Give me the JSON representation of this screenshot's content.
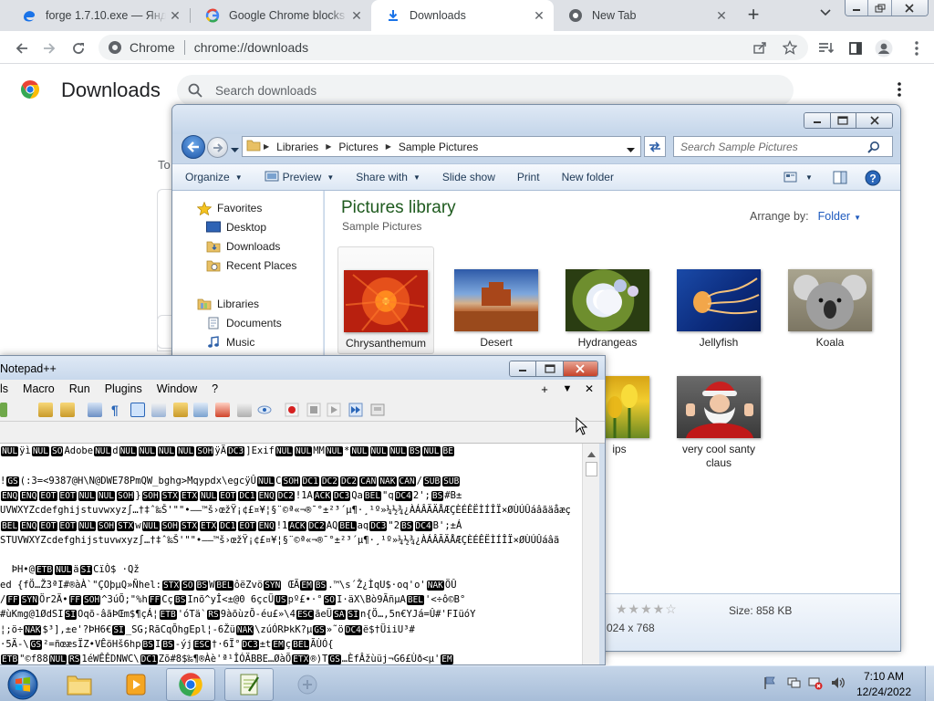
{
  "chrome": {
    "tabs": [
      {
        "label": "forge 1.7.10.exe — Яндекс",
        "icon": "edge-icon",
        "active": false
      },
      {
        "label": "Google Chrome blocks so",
        "icon": "google-g-icon",
        "active": false
      },
      {
        "label": "Downloads",
        "icon": "download-arrow-icon",
        "active": true
      },
      {
        "label": "New Tab",
        "icon": "chrome-icon",
        "active": false
      }
    ],
    "omnibox": {
      "site": "Chrome",
      "url": "chrome://downloads"
    },
    "page": {
      "title": "Downloads",
      "search_placeholder": "Search downloads",
      "date_heading_partial": "To"
    }
  },
  "explorer": {
    "breadcrumb": [
      "Libraries",
      "Pictures",
      "Sample Pictures"
    ],
    "search_placeholder": "Search Sample Pictures",
    "commands": [
      {
        "label": "Organize",
        "dropdown": true
      },
      {
        "label": "Preview",
        "dropdown": true
      },
      {
        "label": "Share with",
        "dropdown": true
      },
      {
        "label": "Slide show",
        "dropdown": false
      },
      {
        "label": "Print",
        "dropdown": false
      },
      {
        "label": "New folder",
        "dropdown": false
      }
    ],
    "nav": {
      "favorites_header": "Favorites",
      "favorites": [
        "Desktop",
        "Downloads",
        "Recent Places"
      ],
      "libraries_header": "Libraries",
      "libraries": [
        "Documents",
        "Music"
      ]
    },
    "library_title": "Pictures library",
    "library_subtitle": "Sample Pictures",
    "arrange_label": "Arrange by:",
    "arrange_value": "Folder",
    "thumbnails_row1": [
      "Chrysanthemum",
      "Desert",
      "Hydrangeas",
      "Jellyfish",
      "Koala"
    ],
    "thumbnails_row2_partial": "ips",
    "thumbnail_extra": "very cool santy claus",
    "details": {
      "size": "Size: 858 KB",
      "dimensions_partial": "024 x 768"
    }
  },
  "notepad": {
    "title_partial": "Notepad++",
    "menus": [
      "ls",
      "Macro",
      "Run",
      "Plugins",
      "Window",
      "?"
    ],
    "menu_right": [
      "+",
      "▼",
      "✕"
    ],
    "lines": [
      {
        "segs": [
          [
            "c",
            "NUL"
          ],
          [
            "t",
            "ÿì"
          ],
          [
            "c",
            "NUL"
          ],
          [
            "c",
            "SO"
          ],
          [
            "t",
            "Adobe"
          ],
          [
            "c",
            "NUL"
          ],
          [
            "t",
            "d"
          ],
          [
            "c",
            "NUL"
          ],
          [
            "c",
            "NUL"
          ],
          [
            "c",
            "NUL"
          ],
          [
            "c",
            "NUL"
          ],
          [
            "c",
            "SOH"
          ],
          [
            "t",
            "ÿÄ"
          ],
          [
            "c",
            "DC3"
          ],
          [
            "t",
            "]Exif"
          ],
          [
            "c",
            "NUL"
          ],
          [
            "c",
            "NUL"
          ],
          [
            "t",
            "MM"
          ],
          [
            "c",
            "NUL"
          ],
          [
            "t",
            "*"
          ],
          [
            "c",
            "NUL"
          ],
          [
            "c",
            "NUL"
          ],
          [
            "c",
            "NUL"
          ],
          [
            "c",
            "BS"
          ],
          [
            "c",
            "NUL"
          ],
          [
            "c",
            "BE"
          ]
        ]
      },
      {
        "segs": []
      },
      {
        "segs": [
          [
            "t",
            "!"
          ],
          [
            "c",
            "GS"
          ],
          [
            "t",
            "(:3=<9387@H\\N@DWE78PmQW_bghg>Mqypdx\\egcÿÛ"
          ],
          [
            "c",
            "NUL"
          ],
          [
            "t",
            "C"
          ],
          [
            "c",
            "SOH"
          ],
          [
            "c",
            "DC1"
          ],
          [
            "c",
            "DC2"
          ],
          [
            "c",
            "DC2"
          ],
          [
            "c",
            "CAN"
          ],
          [
            "c",
            "NAK"
          ],
          [
            "c",
            "CAN"
          ],
          [
            "t",
            "/"
          ],
          [
            "c",
            "SUB"
          ],
          [
            "c",
            "SUB"
          ]
        ]
      },
      {
        "segs": [
          [
            "c",
            "ENQ"
          ],
          [
            "c",
            "ENQ"
          ],
          [
            "c",
            "EOT"
          ],
          [
            "c",
            "EOT"
          ],
          [
            "c",
            "NUL"
          ],
          [
            "c",
            "NUL"
          ],
          [
            "c",
            "SOH"
          ],
          [
            "t",
            "}"
          ],
          [
            "c",
            "SOH"
          ],
          [
            "c",
            "STX"
          ],
          [
            "c",
            "ETX"
          ],
          [
            "c",
            "NUL"
          ],
          [
            "c",
            "EOT"
          ],
          [
            "c",
            "DC1"
          ],
          [
            "c",
            "ENQ"
          ],
          [
            "c",
            "DC2"
          ],
          [
            "t",
            "!1A"
          ],
          [
            "c",
            "ACK"
          ],
          [
            "c",
            "DC3"
          ],
          [
            "t",
            "Qa"
          ],
          [
            "c",
            "BEL"
          ],
          [
            "t",
            "\"q"
          ],
          [
            "c",
            "DC4"
          ],
          [
            "t",
            "2';"
          ],
          [
            "c",
            "BS"
          ],
          [
            "t",
            "#B±"
          ]
        ]
      },
      {
        "segs": [
          [
            "t",
            "UVWXYZcdefghijstuvwxyz∫…†‡ˆ‰Š'\"\"•–—™š›œžŸ¡¢£¤¥¦§¨©ª«¬­®¯°±²³´µ¶·¸¹º»¼½¾¿ÀÁÂÃÄÅÆÇÈÉÊËÌÍÎÏ×ØÙÚÛáâãäåæç"
          ]
        ]
      },
      {
        "segs": [
          [
            "c",
            "BEL"
          ],
          [
            "c",
            "ENQ"
          ],
          [
            "c",
            "EOT"
          ],
          [
            "c",
            "EOT"
          ],
          [
            "c",
            "NUL"
          ],
          [
            "c",
            "SOH"
          ],
          [
            "c",
            "STX"
          ],
          [
            "t",
            "w"
          ],
          [
            "c",
            "NUL"
          ],
          [
            "c",
            "SOH"
          ],
          [
            "c",
            "STX"
          ],
          [
            "c",
            "ETX"
          ],
          [
            "c",
            "DC1"
          ],
          [
            "c",
            "EOT"
          ],
          [
            "c",
            "ENQ"
          ],
          [
            "t",
            "!1"
          ],
          [
            "c",
            "ACK"
          ],
          [
            "c",
            "DC2"
          ],
          [
            "t",
            "AQ"
          ],
          [
            "c",
            "BEL"
          ],
          [
            "t",
            "aq"
          ],
          [
            "c",
            "DC3"
          ],
          [
            "t",
            "\"2"
          ],
          [
            "c",
            "BS"
          ],
          [
            "c",
            "DC4"
          ],
          [
            "t",
            "B';±Á"
          ]
        ]
      },
      {
        "segs": [
          [
            "t",
            "STUVWXYZcdefghijstuvwxyz∫…†‡ˆ‰Š'\"\"•–—™š›œžŸ¡¢£¤¥¦§¨©ª«¬­®¯°±²³´µ¶·¸¹º»¼½¾¿ÀÁÂÃÄÅÆÇÈÉÊËÌÍÎÏ×ØÙÚÛáâã"
          ]
        ]
      },
      {
        "segs": []
      },
      {
        "segs": [
          [
            "t",
            "  ÞH•@"
          ],
          [
            "c",
            "ETB"
          ],
          [
            "c",
            "NUL"
          ],
          [
            "t",
            "ä"
          ],
          [
            "c",
            "SI"
          ],
          [
            "t",
            "CïÒ$ ·Qž"
          ]
        ]
      },
      {
        "segs": [
          [
            "t",
            "ed {fÖ…Ž3ªI#®àÀ`\"ÇOþµQ»Ñhel:"
          ],
          [
            "c",
            "STX"
          ],
          [
            "c",
            "SO"
          ],
          [
            "c",
            "BS"
          ],
          [
            "t",
            "W"
          ],
          [
            "c",
            "BEL"
          ],
          [
            "t",
            "ôëZvö"
          ],
          [
            "c",
            "SYN"
          ],
          [
            "t",
            " ŒÃ"
          ],
          [
            "c",
            "EM"
          ],
          [
            "c",
            "BS"
          ],
          [
            "t",
            "."
          ],
          [
            "t",
            "™\\s´Ž¿ÌqU$·oq'o'"
          ],
          [
            "c",
            "NAK"
          ],
          [
            "t",
            "ÖÛ"
          ]
        ]
      },
      {
        "segs": [
          [
            "t",
            "/"
          ],
          [
            "c",
            "FF"
          ],
          [
            "c",
            "SYN"
          ],
          [
            "t",
            "Ör2Ä•"
          ],
          [
            "c",
            "FF"
          ],
          [
            "c",
            "SOH"
          ],
          [
            "t",
            "^3úÕ;\"%h"
          ],
          [
            "c",
            "FF"
          ],
          [
            "t",
            "Cç"
          ],
          [
            "c",
            "BS"
          ],
          [
            "t",
            "Inõ^yÎ<±@0 6çcÜ"
          ],
          [
            "c",
            "US"
          ],
          [
            "t",
            "pº£•·°"
          ],
          [
            "c",
            "SO"
          ],
          [
            "t",
            "I·äX\\Bò9ÃñµA"
          ],
          [
            "c",
            "BEL"
          ],
          [
            "t",
            "'<÷ô©B°"
          ]
        ]
      },
      {
        "segs": [
          [
            "t",
            "#ùKmg@1ØdSI"
          ],
          [
            "c",
            "SI"
          ],
          [
            "t",
            "Oqõ-âãÞŒm$¶çÁ¦"
          ],
          [
            "c",
            "ETB"
          ],
          [
            "t",
            "'óTä`"
          ],
          [
            "c",
            "RS"
          ],
          [
            "t",
            "9àõùzÕ-éu£»\\4"
          ],
          [
            "c",
            "ESC"
          ],
          [
            "t",
            "ãeÜ"
          ],
          [
            "c",
            "SA"
          ],
          [
            "c",
            "SI"
          ],
          [
            "t",
            "n{Ö…,5n€YJá=Û#'FIüóY"
          ]
        ]
      },
      {
        "segs": [
          [
            "t",
            "¦;ö÷"
          ],
          [
            "c",
            "NAK"
          ],
          [
            "t",
            "$³],±e'?ÞH6€"
          ],
          [
            "c",
            "SI"
          ],
          [
            "t",
            "_SG;RãCqÕhgEpl¦-6Ž"
          ],
          [
            "t",
            "ü"
          ],
          [
            "c",
            "NAK"
          ],
          [
            "t",
            "\\zúÓRÞkK?µ"
          ],
          [
            "c",
            "GS"
          ],
          [
            "t",
            "»˜ö"
          ],
          [
            "c",
            "DC4"
          ],
          [
            "t",
            "ë$†ÜiiU³#"
          ]
        ]
      },
      {
        "segs": [
          [
            "t",
            "·5Ä-\\"
          ],
          [
            "c",
            "GS"
          ],
          [
            "t",
            "²=ñœæsÏZ•VÊöHš6hp"
          ],
          [
            "c",
            "BS"
          ],
          [
            "t",
            "I"
          ],
          [
            "c",
            "BS"
          ],
          [
            "t",
            "-ýj"
          ],
          [
            "c",
            "ESC"
          ],
          [
            "t",
            "†·6Ï°"
          ],
          [
            "c",
            "DC3"
          ],
          [
            "t",
            "±t"
          ],
          [
            "c",
            "EM"
          ],
          [
            "t",
            "ç"
          ],
          [
            "c",
            "BEL"
          ],
          [
            "t",
            "ÃÙÓ{"
          ]
        ]
      },
      {
        "segs": [
          [
            "c",
            "ETB"
          ],
          [
            "t",
            "\"©f88"
          ],
          [
            "c",
            "NUL"
          ],
          [
            "c",
            "RS"
          ],
          [
            "t",
            "1éWÊÊDNWC\\"
          ],
          [
            "c",
            "DC1"
          ],
          [
            "t",
            "Zõ#8$‰¶®Àè'ª¹ÎÓÄBBE…ØàÕ"
          ],
          [
            "c",
            "ETX"
          ],
          [
            "t",
            "®)T"
          ],
          [
            "c",
            "GS"
          ],
          [
            "t",
            "…ÈfÂžùüj¬G6£Ùð<µ'"
          ],
          [
            "c",
            "EM"
          ]
        ]
      }
    ]
  },
  "explorer_details_rating": "★★★★☆",
  "taskbar": {
    "clock_time": "7:10 AM",
    "clock_date": "12/24/2022"
  },
  "colors": {
    "chrome_tabstrip": "#dee1e6",
    "explorer_frame": "#c7d7ea",
    "library_title": "#1e5a1e",
    "taskbar": "#b4c8e0"
  }
}
